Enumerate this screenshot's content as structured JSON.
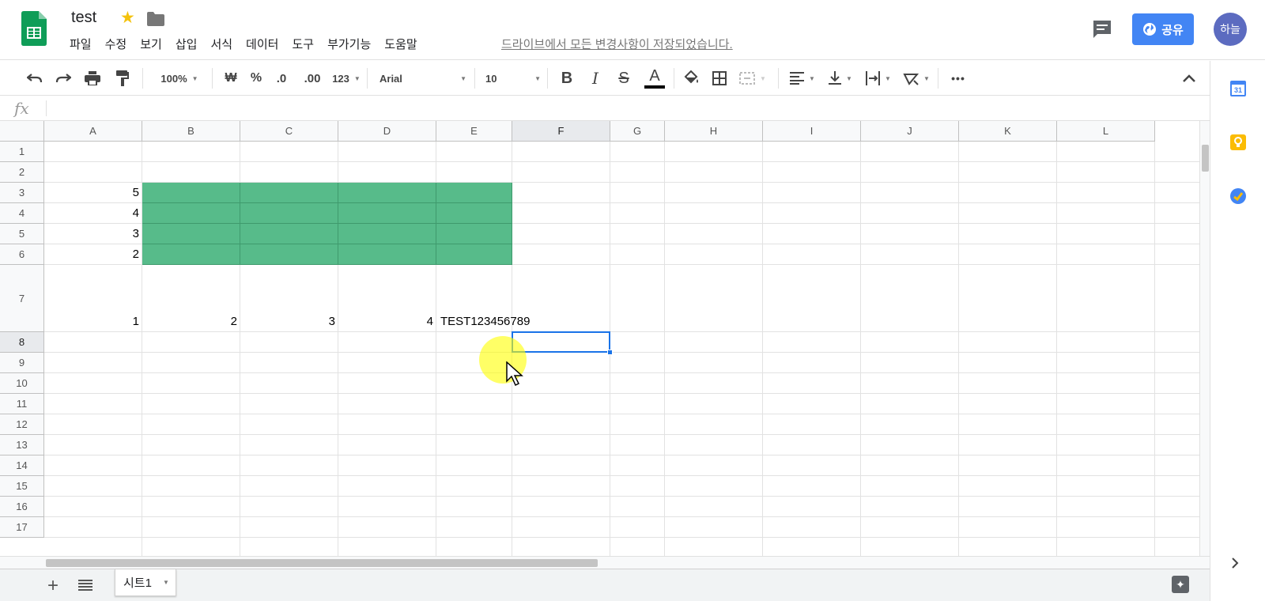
{
  "app": {
    "doc_title": "test",
    "save_status": "드라이브에서 모든 변경사항이 저장되었습니다.",
    "share_label": "공유",
    "user_avatar": "하늘"
  },
  "menu": [
    "파일",
    "수정",
    "보기",
    "삽입",
    "서식",
    "데이터",
    "도구",
    "부가기능",
    "도움말"
  ],
  "toolbar": {
    "zoom": "100%",
    "currency": "₩",
    "percent": "%",
    "decimal_decrease": ".0",
    "decimal_increase": ".00",
    "number_format": "123",
    "font": "Arial",
    "font_size": "10",
    "bold": "B",
    "italic": "I",
    "strikethrough": "S",
    "text_color": "A",
    "more": "•••"
  },
  "formula_bar": {
    "label": "fx",
    "value": ""
  },
  "grid": {
    "columns": [
      "A",
      "B",
      "C",
      "D",
      "E",
      "F",
      "G",
      "H",
      "I",
      "J",
      "K",
      "L"
    ],
    "rows": [
      "1",
      "2",
      "3",
      "4",
      "5",
      "6",
      "7",
      "8",
      "9",
      "10",
      "11",
      "12",
      "13",
      "14",
      "15",
      "16",
      "17"
    ],
    "cells": {
      "A3": "5",
      "A4": "4",
      "A5": "3",
      "A6": "2",
      "A7": "1",
      "B7": "2",
      "C7": "3",
      "D7": "4",
      "E7": "TEST123456789"
    },
    "fill_color": "#57bb8a",
    "selected_cell": "F8"
  },
  "sheets": {
    "tabs": [
      "시트1"
    ]
  },
  "side_panel": {
    "calendar_day": "31"
  }
}
